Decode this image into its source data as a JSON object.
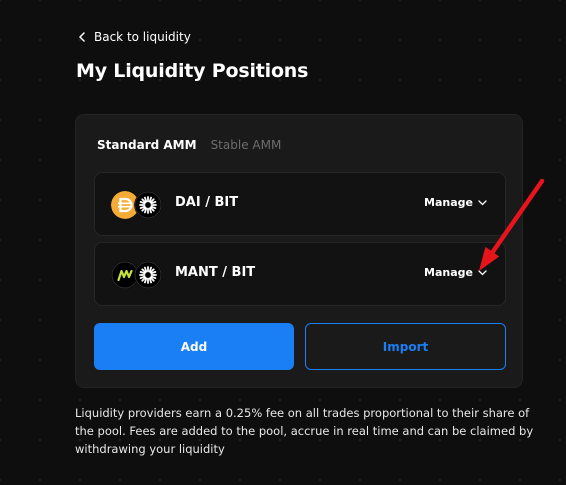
{
  "nav": {
    "back_label": "Back to liquidity"
  },
  "page": {
    "title": "My Liquidity Positions"
  },
  "tabs": [
    {
      "label": "Standard AMM",
      "active": true
    },
    {
      "label": "Stable AMM",
      "active": false
    }
  ],
  "positions": [
    {
      "pair": "DAI / BIT",
      "manage_label": "Manage",
      "token_a_icon": "dai-icon",
      "token_b_icon": "bit-icon"
    },
    {
      "pair": "MANT / BIT",
      "manage_label": "Manage",
      "token_a_icon": "mant-icon",
      "token_b_icon": "bit-icon"
    }
  ],
  "actions": {
    "add_label": "Add",
    "import_label": "Import"
  },
  "info_text": "Liquidity providers earn a 0.25% fee on all trades proportional to their share of the pool. Fees are added to the pool, accrue in real time and can be claimed by withdrawing your liquidity",
  "colors": {
    "background": "#0e0e0e",
    "card": "#1a1a1a",
    "accent": "#1a7ff5",
    "dai": "#f5ac37",
    "mant": "#c4e33b",
    "annotation": "#e8141c"
  }
}
